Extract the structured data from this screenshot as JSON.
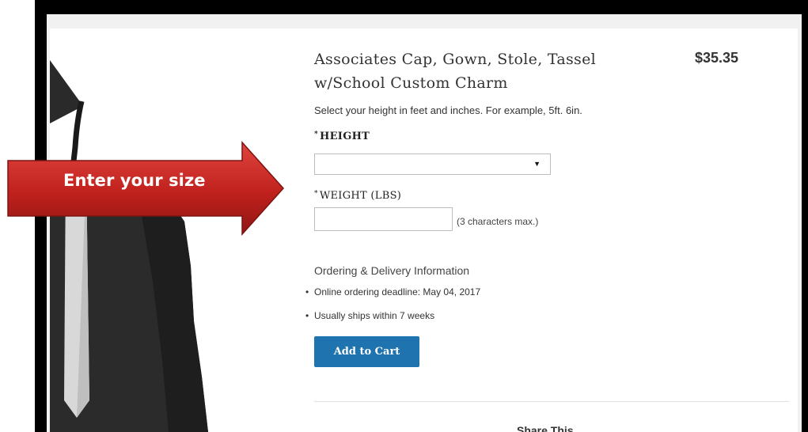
{
  "product": {
    "title_line1": "Associates Cap, Gown, Stole, Tassel",
    "title_line2": "w/School Custom Charm",
    "price": "$35.35",
    "instructions": "Select your height in feet and inches. For example, 5ft. 6in."
  },
  "form": {
    "required_marker": "*",
    "height_label": "HEIGHT",
    "height_value": "",
    "weight_label": "WEIGHT (LBS)",
    "weight_value": "",
    "weight_hint": "(3 characters max.)"
  },
  "ordering": {
    "heading": "Ordering & Delivery Information",
    "bullet": "•",
    "items": [
      "Online ordering deadline: May 04, 2017",
      "Usually ships within 7 weeks"
    ]
  },
  "actions": {
    "add_to_cart": "Add to Cart"
  },
  "share": {
    "label": "Share This"
  },
  "callout": {
    "text": "Enter your size"
  },
  "colors": {
    "button_blue": "#1f73ae",
    "arrow_red": "#c0211d",
    "page_gray": "#f1f1f1"
  }
}
